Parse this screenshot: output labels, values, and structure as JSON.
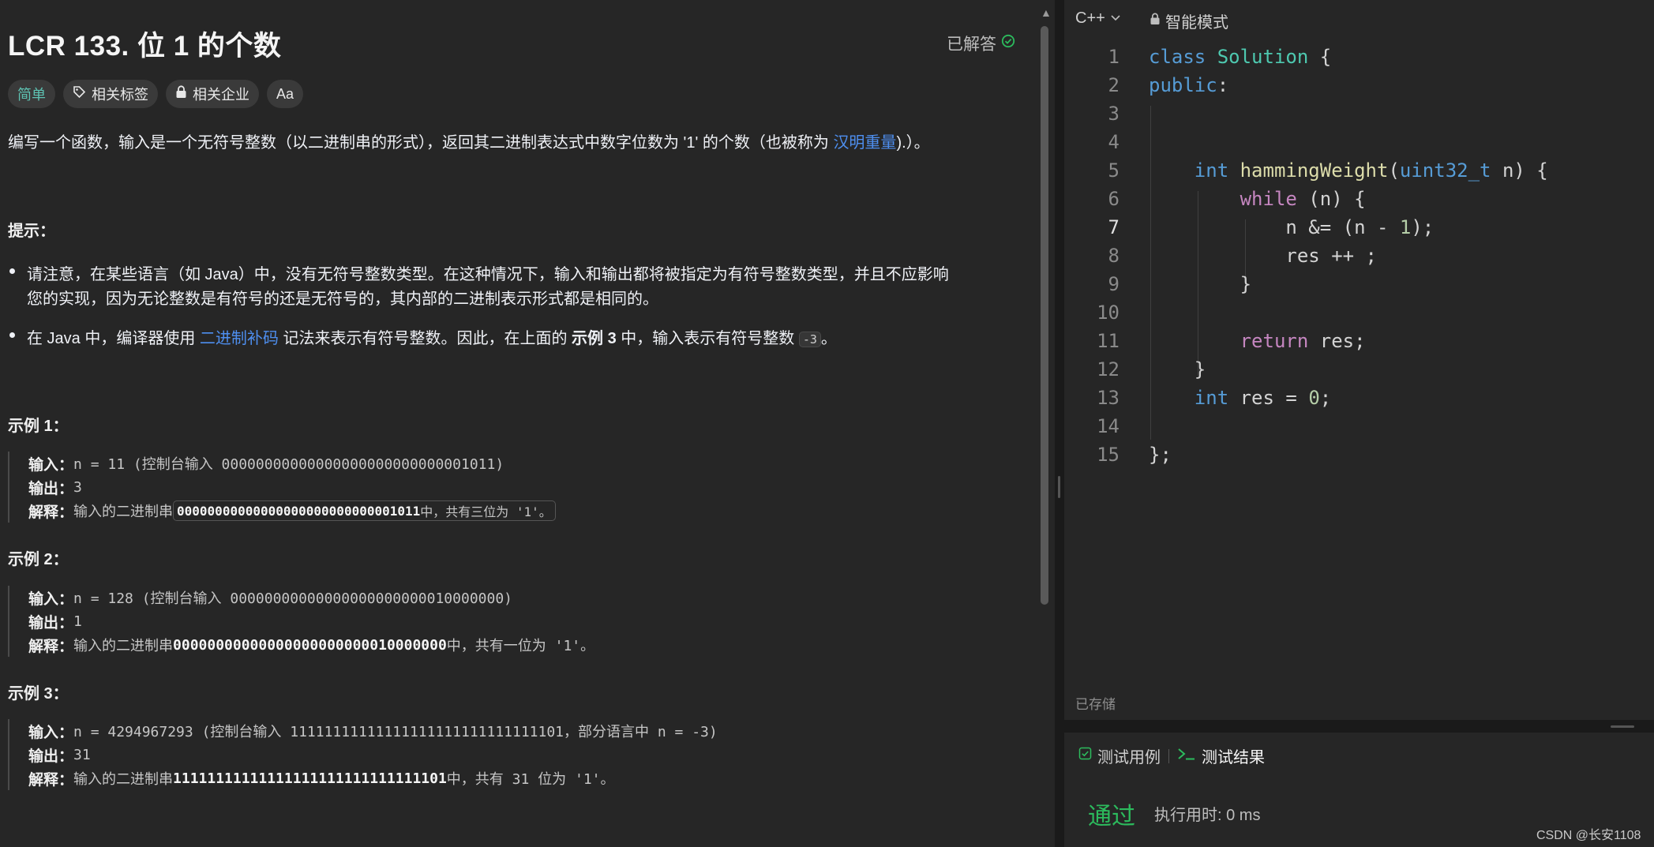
{
  "problem": {
    "title": "LCR 133. 位 1 的个数",
    "status": "已解答",
    "tags": [
      "简单",
      "相关标签",
      "相关企业",
      "Aa"
    ],
    "desc_before_link": "编写一个函数，输入是一个无符号整数（以二进制串的形式），返回其二进制表达式中数字位数为 '1' 的个数（也被称为 ",
    "desc_link": "汉明重量",
    "desc_after_link": ").）。",
    "hints_heading": "提示：",
    "hint1_line1": "请注意，在某些语言（如 Java）中，没有无符号整数类型。在这种情况下，输入和输出都将被指定为有符号整数类型，并且不应影响",
    "hint1_line2": "您的实现，因为无论整数是有符号的还是无符号的，其内部的二进制表示形式都是相同的。",
    "hint2_a": "在 Java 中，编译器使用 ",
    "hint2_link": "二进制补码",
    "hint2_b": " 记法来表示有符号整数。因此，在上面的 ",
    "hint2_bold": "示例 3",
    "hint2_c": " 中，输入表示有符号整数 ",
    "hint2_code": "-3",
    "hint2_end": "。",
    "examples": [
      {
        "heading": "示例 1：",
        "input_label": "输入：",
        "input": "n = 11 (控制台输入 00000000000000000000000000001011)",
        "output_label": "输出：",
        "output": "3",
        "explain_label": "解释：",
        "explain_a": "输入的二进制串 ",
        "explain_bold": "00000000000000000000000000001011",
        "explain_b": " 中，共有三位为 '1'。"
      },
      {
        "heading": "示例 2：",
        "input_label": "输入：",
        "input": "n = 128 (控制台输入 00000000000000000000000010000000)",
        "output_label": "输出：",
        "output": "1",
        "explain_label": "解释：",
        "explain_a": "输入的二进制串 ",
        "explain_bold": "00000000000000000000000010000000",
        "explain_b": " 中，共有一位为 '1'。"
      },
      {
        "heading": "示例 3：",
        "input_label": "输入：",
        "input": "n = 4294967293 (控制台输入 11111111111111111111111111111101，部分语言中 n = -3)",
        "output_label": "输出：",
        "output": "31",
        "explain_label": "解释：",
        "explain_a": "输入的二进制串 ",
        "explain_bold": "11111111111111111111111111111101",
        "explain_b": " 中，共有 31 位为 '1'。"
      }
    ]
  },
  "editor": {
    "language": "C++",
    "mode": "智能模式",
    "saved_status": "已存储",
    "current_line": 7,
    "line_numbers": [
      "1",
      "2",
      "3",
      "4",
      "5",
      "6",
      "7",
      "8",
      "9",
      "10",
      "11",
      "12",
      "13",
      "14",
      "15"
    ]
  },
  "test_panel": {
    "tab_cases": "测试用例",
    "tab_result": "测试结果",
    "result": "通过",
    "runtime": "执行用时: 0 ms"
  },
  "watermark": "CSDN @长安1108",
  "icons": {
    "status": "check-circle-icon",
    "tag": "tag-icon",
    "lock": "lock-icon",
    "chevron": "chevron-down-icon",
    "checkbox": "checkbox-icon",
    "terminal": "terminal-icon"
  },
  "colors": {
    "accent_green": "#2cbb5d",
    "easy": "#5ec3b3",
    "link": "#4e8ff0"
  }
}
